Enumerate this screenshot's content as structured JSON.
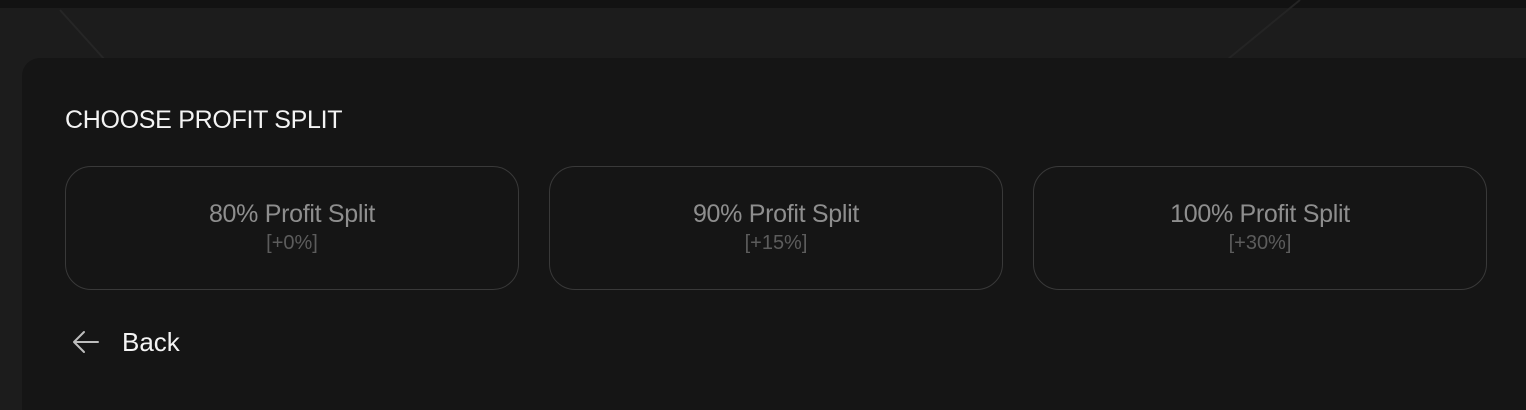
{
  "section": {
    "title": "CHOOSE PROFIT SPLIT"
  },
  "options": [
    {
      "label": "80% Profit Split",
      "modifier": "[+0%]"
    },
    {
      "label": "90% Profit Split",
      "modifier": "[+15%]"
    },
    {
      "label": "100% Profit Split",
      "modifier": "[+30%]"
    }
  ],
  "back": {
    "label": "Back",
    "icon": "arrow-left-icon"
  },
  "colors": {
    "background": "#1c1c1c",
    "panel": "#141414",
    "card_border": "#393939",
    "title_text": "#f4f4f4",
    "option_text": "#8e8e8e",
    "modifier_text": "#5c5c5c"
  }
}
